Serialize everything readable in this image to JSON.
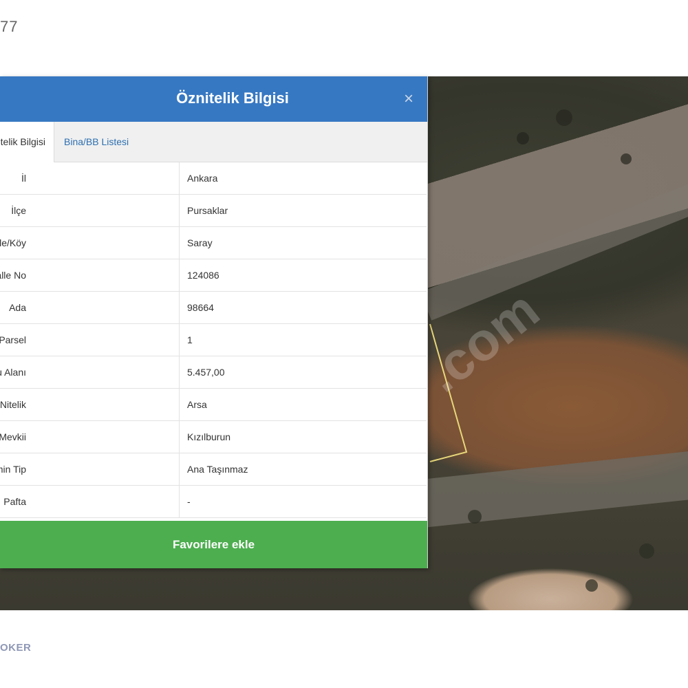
{
  "page": {
    "top_number": "77",
    "bottom_logo": "OKER"
  },
  "map": {
    "watermark": ".com"
  },
  "dialog": {
    "title": "Öznitelik Bilgisi",
    "close_icon": "×",
    "tabs": [
      {
        "label": "Öznitelik Bilgisi",
        "active": true
      },
      {
        "label": "Bina/BB Listesi",
        "active": false
      }
    ],
    "rows": [
      {
        "label": "İl",
        "value": "Ankara"
      },
      {
        "label": "İlçe",
        "value": "Pursaklar"
      },
      {
        "label": "Mahalle/Köy",
        "value": "Saray"
      },
      {
        "label": "Mahalle No",
        "value": "124086"
      },
      {
        "label": "Ada",
        "value": "98664"
      },
      {
        "label": "Parsel",
        "value": "1"
      },
      {
        "label": "Tapu Alanı",
        "value": "5.457,00"
      },
      {
        "label": "Nitelik",
        "value": "Arsa"
      },
      {
        "label": "Mevkii",
        "value": "Kızılburun"
      },
      {
        "label": "Zemin Tip",
        "value": "Ana Taşınmaz"
      },
      {
        "label": "Pafta",
        "value": "-"
      }
    ],
    "favorite_button": "Favorilere ekle"
  },
  "colors": {
    "header": "#3778c2",
    "button": "#4dae4f",
    "tab_link": "#2d6fb0"
  }
}
